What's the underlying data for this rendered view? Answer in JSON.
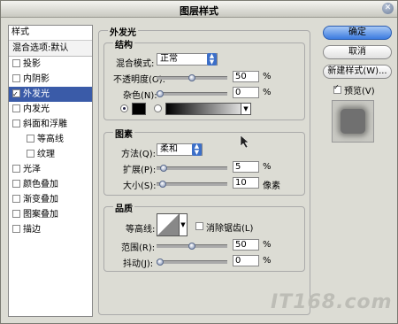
{
  "window": {
    "title": "图层样式"
  },
  "left_panel": {
    "header": "样式",
    "blend_options": "混合选项:默认",
    "items": [
      {
        "label": "投影",
        "checked": false,
        "sub": false,
        "selected": false
      },
      {
        "label": "内阴影",
        "checked": false,
        "sub": false,
        "selected": false
      },
      {
        "label": "外发光",
        "checked": true,
        "sub": false,
        "selected": true
      },
      {
        "label": "内发光",
        "checked": false,
        "sub": false,
        "selected": false
      },
      {
        "label": "斜面和浮雕",
        "checked": false,
        "sub": false,
        "selected": false
      },
      {
        "label": "等高线",
        "checked": false,
        "sub": true,
        "selected": false
      },
      {
        "label": "纹理",
        "checked": false,
        "sub": true,
        "selected": false
      },
      {
        "label": "光泽",
        "checked": false,
        "sub": false,
        "selected": false
      },
      {
        "label": "颜色叠加",
        "checked": false,
        "sub": false,
        "selected": false
      },
      {
        "label": "渐变叠加",
        "checked": false,
        "sub": false,
        "selected": false
      },
      {
        "label": "图案叠加",
        "checked": false,
        "sub": false,
        "selected": false
      },
      {
        "label": "描边",
        "checked": false,
        "sub": false,
        "selected": false
      }
    ]
  },
  "outer_glow": {
    "title": "外发光",
    "structure": {
      "title": "结构",
      "blend_mode_label": "混合模式:",
      "blend_mode_value": "正常",
      "opacity_label": "不透明度(O):",
      "opacity_value": "50",
      "opacity_level": 0.5,
      "noise_label": "杂色(N):",
      "noise_value": "0",
      "noise_level": 0.0,
      "percent": "%",
      "glow_color": "#000000"
    },
    "elements": {
      "title": "图素",
      "method_label": "方法(Q):",
      "method_value": "柔和",
      "spread_label": "扩展(P):",
      "spread_value": "5",
      "spread_level": 0.05,
      "size_label": "大小(S):",
      "size_value": "10",
      "size_level": 0.04,
      "percent": "%",
      "pixels": "像素"
    },
    "quality": {
      "title": "品质",
      "contour_label": "等高线:",
      "antialias_label": "消除锯齿(L)",
      "range_label": "范围(R):",
      "range_value": "50",
      "range_level": 0.5,
      "jitter_label": "抖动(J):",
      "jitter_value": "0",
      "jitter_level": 0.0,
      "percent": "%"
    }
  },
  "buttons": {
    "ok": "确定",
    "cancel": "取消",
    "new_style": "新建样式(W)...",
    "preview": "预览(V)"
  },
  "watermark": "IT168.com"
}
